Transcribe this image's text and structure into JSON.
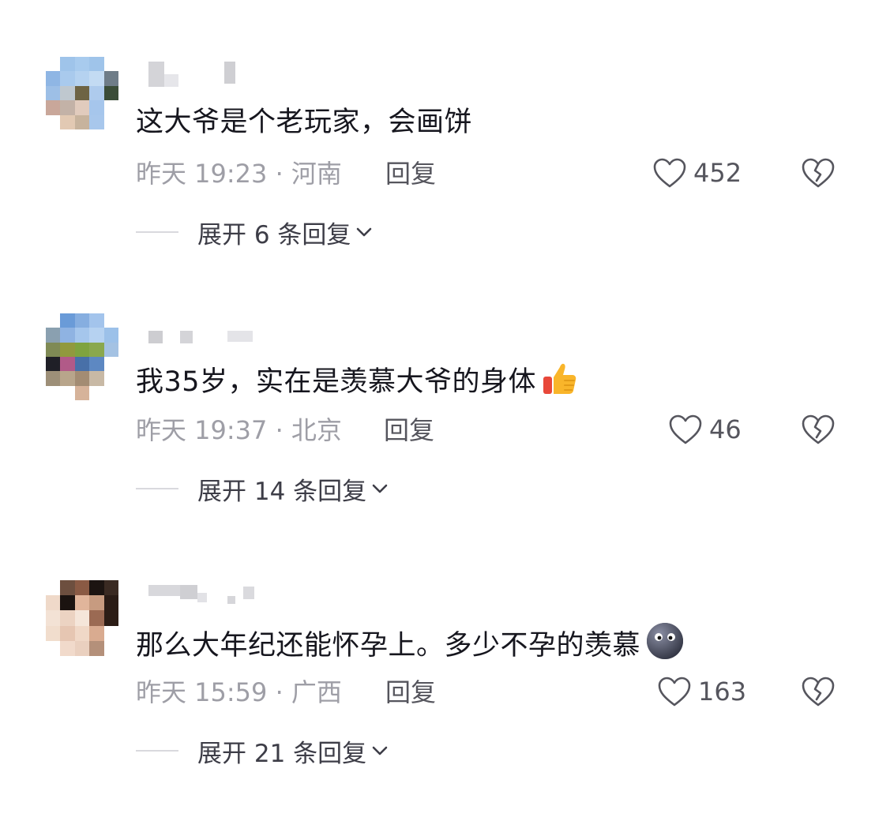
{
  "comments": [
    {
      "text": "这大爷是个老玩家，会画饼",
      "meta": "昨天 19:23 · 河南",
      "reply_label": "回复",
      "likes": "452",
      "expand_label": "展开 6 条回复",
      "emoji": ""
    },
    {
      "text": "我35岁，实在是羡慕大爷的身体",
      "meta": "昨天 19:37 · 北京",
      "reply_label": "回复",
      "likes": "46",
      "expand_label": "展开 14 条回复",
      "emoji": "thumbs-up-icon"
    },
    {
      "text": "那么大年纪还能怀孕上。多少不孕的羡慕",
      "meta": "昨天 15:59 · 广西",
      "reply_label": "回复",
      "likes": "163",
      "expand_label": "展开 21 条回复",
      "emoji": "dark-face-icon"
    }
  ],
  "icons": {
    "like": "heart-outline-icon",
    "dislike": "broken-heart-icon",
    "expand": "chevron-down-icon"
  },
  "colors": {
    "meta_text": "#9e9ea6",
    "action_text": "#55555d",
    "body_text": "#16161e"
  }
}
